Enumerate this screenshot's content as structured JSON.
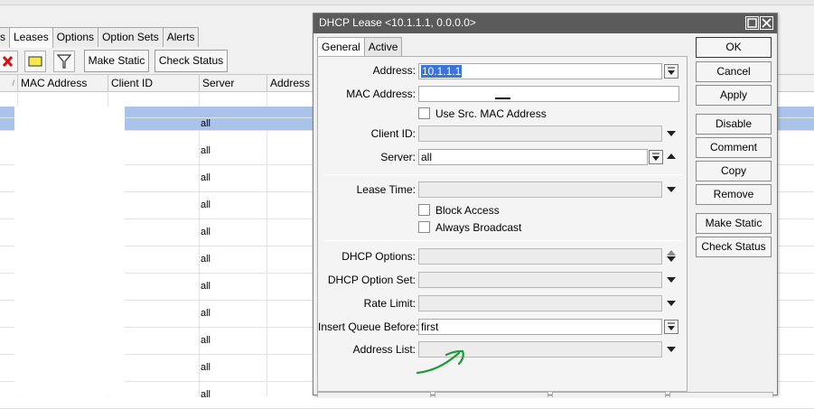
{
  "background_window": {
    "tabs": [
      {
        "label": "s",
        "active": false
      },
      {
        "label": "Leases",
        "active": true
      },
      {
        "label": "Options",
        "active": false
      },
      {
        "label": "Option Sets",
        "active": false
      },
      {
        "label": "Alerts",
        "active": false
      }
    ],
    "toolbar": {
      "remove_icon": "x-icon",
      "comment_icon": "note-icon",
      "filter_icon": "filter-icon",
      "make_static_label": "Make Static",
      "check_status_label": "Check Status"
    },
    "columns": [
      "/",
      "MAC Address",
      "Client ID",
      "Server",
      "Address Li"
    ],
    "rows": [
      {
        "server": ""
      },
      {
        "server": "all"
      },
      {
        "server": "all"
      },
      {
        "server": "all"
      },
      {
        "server": "all"
      },
      {
        "server": "all"
      },
      {
        "server": "all"
      },
      {
        "server": "all"
      },
      {
        "server": "all"
      },
      {
        "server": "all"
      },
      {
        "server": "all"
      },
      {
        "server": "all"
      }
    ]
  },
  "dialog": {
    "title": "DHCP Lease <10.1.1.1, 0.0.0.0>",
    "minimize_icon": "restore-icon",
    "close_icon": "close-icon",
    "tabs": [
      {
        "label": "General",
        "active": true
      },
      {
        "label": "Active",
        "active": false
      }
    ],
    "fields": {
      "address": {
        "label": "Address:",
        "value": "10.1.1.1"
      },
      "mac_address": {
        "label": "MAC Address:",
        "value": ""
      },
      "use_src_mac": {
        "label": "Use Src. MAC Address",
        "checked": false
      },
      "client_id": {
        "label": "Client ID:",
        "value": ""
      },
      "server": {
        "label": "Server:",
        "value": "all"
      },
      "lease_time": {
        "label": "Lease Time:",
        "value": ""
      },
      "block_access": {
        "label": "Block Access",
        "checked": false
      },
      "always_broadcast": {
        "label": "Always Broadcast",
        "checked": false
      },
      "dhcp_options": {
        "label": "DHCP Options:",
        "value": ""
      },
      "dhcp_option_set": {
        "label": "DHCP Option Set:",
        "value": ""
      },
      "rate_limit": {
        "label": "Rate Limit:",
        "value": ""
      },
      "insert_queue_before": {
        "label": "Insert Queue Before:",
        "value": "first"
      },
      "address_list": {
        "label": "Address List:",
        "value": ""
      }
    },
    "buttons": {
      "ok": "OK",
      "cancel": "Cancel",
      "apply": "Apply",
      "disable": "Disable",
      "comment": "Comment",
      "copy": "Copy",
      "remove": "Remove",
      "make_static": "Make Static",
      "check_status": "Check Status"
    },
    "colors": {
      "title_bar": "#5b5b5b",
      "selection": "#3a74d8",
      "row_highlight": "#a9c3ea",
      "annotation_arrow": "#1e9a3a"
    }
  }
}
